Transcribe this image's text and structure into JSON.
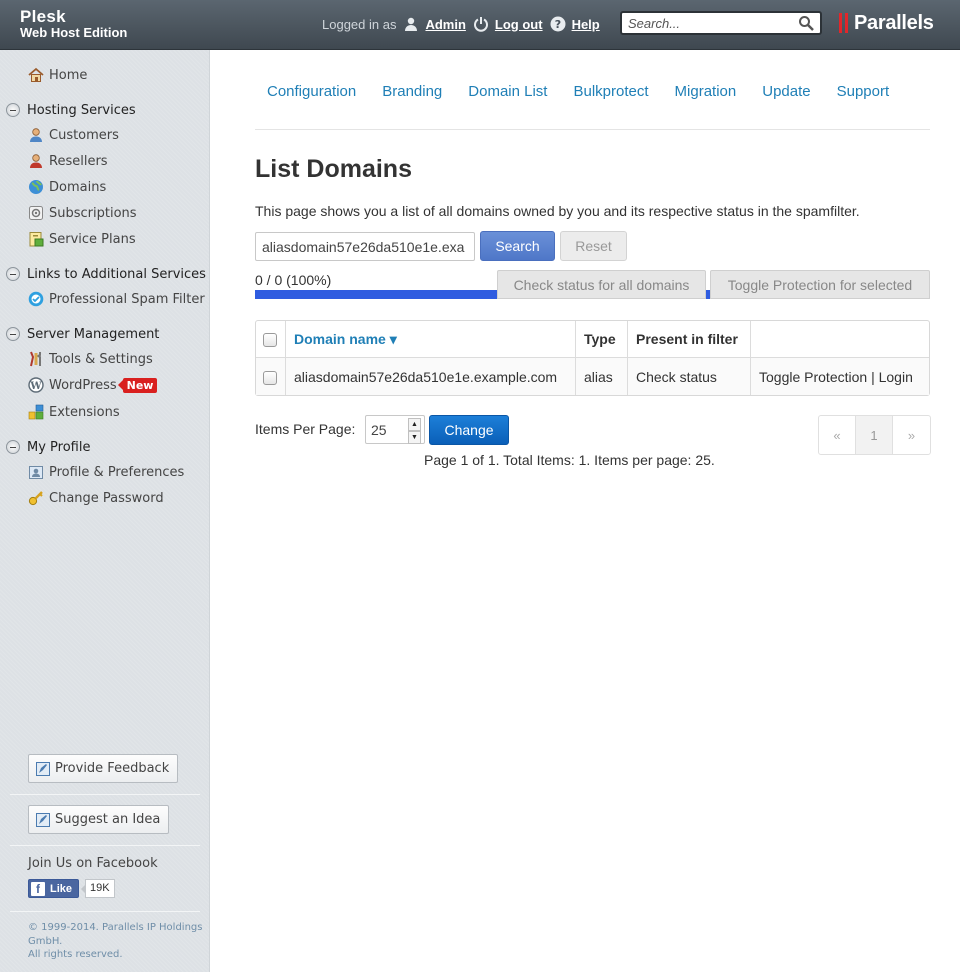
{
  "header": {
    "product": "Plesk",
    "edition": "Web Host Edition",
    "logged_in_as": "Logged in as",
    "user": "Admin",
    "logout": "Log out",
    "help": "Help",
    "search_placeholder": "Search...",
    "brand": "Parallels"
  },
  "sidebar": {
    "home": "Home",
    "groups": [
      {
        "label": "Hosting Services",
        "items": [
          "Customers",
          "Resellers",
          "Domains",
          "Subscriptions",
          "Service Plans"
        ]
      },
      {
        "label": "Links to Additional Services",
        "items": [
          "Professional Spam Filter"
        ]
      },
      {
        "label": "Server Management",
        "items": [
          "Tools & Settings",
          "WordPress",
          "Extensions"
        ]
      },
      {
        "label": "My Profile",
        "items": [
          "Profile & Preferences",
          "Change Password"
        ]
      }
    ],
    "wordpress_badge": "New",
    "feedback": "Provide Feedback",
    "suggest": "Suggest an Idea",
    "facebook": "Join Us on Facebook",
    "like": "Like",
    "like_count": "19K",
    "copyright": "© 1999-2014. Parallels IP Holdings GmbH.",
    "rights": "All rights reserved."
  },
  "main": {
    "tabs": [
      "Configuration",
      "Branding",
      "Domain List",
      "Bulkprotect",
      "Migration",
      "Update",
      "Support"
    ],
    "title": "List Domains",
    "description": "This page shows you a list of all domains owned by you and its respective status in the spamfilter.",
    "filter_value": "aliasdomain57e26da510e1e.exa",
    "search_button": "Search",
    "reset_button": "Reset",
    "progress_text": "0 / 0 (100%)",
    "progress_fraction": 1.0,
    "check_all_button": "Check status for all domains",
    "toggle_selected_button": "Toggle Protection for selected",
    "table": {
      "headers": [
        "Domain name ▾",
        "Type",
        "Present in filter",
        ""
      ],
      "rows": [
        {
          "domain": "aliasdomain57e26da510e1e.example.com",
          "type": "alias",
          "present": "Check status",
          "toggle": "Toggle Protection",
          "sep": "|",
          "login": "Login"
        }
      ]
    },
    "items_per_page_label": "Items Per Page:",
    "items_per_page_value": "25",
    "change_button": "Change",
    "summary": "Page 1 of 1. Total Items: 1. Items per page: 25.",
    "pager": {
      "prev": "«",
      "current": "1",
      "next": "»"
    }
  }
}
